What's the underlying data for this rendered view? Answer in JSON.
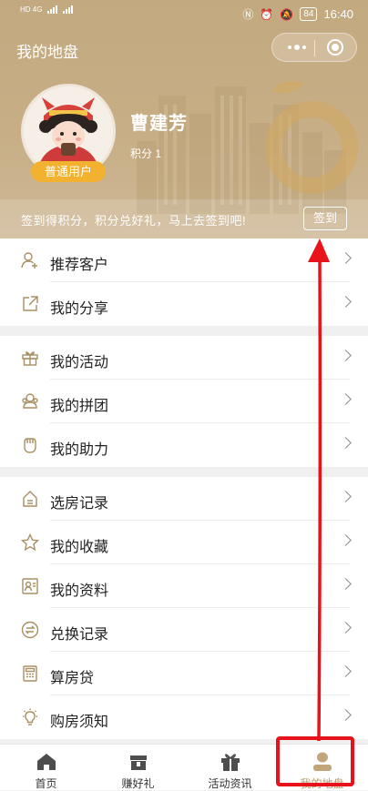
{
  "status_bar": {
    "left_text": "HD 4G",
    "battery": "84",
    "time": "16:40",
    "icons": [
      "nfc-icon",
      "alarm-icon",
      "mute-icon",
      "battery-icon"
    ]
  },
  "header": {
    "title": "我的地盘",
    "capsule": {
      "more_icon": "more-dots-icon",
      "close_icon": "target-icon"
    }
  },
  "profile": {
    "name": "曹建芳",
    "points": "积分 1",
    "badge": "普通用户",
    "avatar_icon": "child-avatar"
  },
  "signin": {
    "text": "签到得积分，积分兑好礼，马上去签到吧!",
    "button": "签到"
  },
  "menu": {
    "groups": [
      [
        {
          "label": "推荐客户",
          "icon": "person-add-icon"
        },
        {
          "label": "我的分享",
          "icon": "share-icon"
        }
      ],
      [
        {
          "label": "我的活动",
          "icon": "gift-icon"
        },
        {
          "label": "我的拼团",
          "icon": "group-icon"
        },
        {
          "label": "我的助力",
          "icon": "fist-icon"
        }
      ],
      [
        {
          "label": "选房记录",
          "icon": "house-record-icon"
        },
        {
          "label": "我的收藏",
          "icon": "star-icon"
        },
        {
          "label": "我的资料",
          "icon": "profile-card-icon"
        },
        {
          "label": "兑换记录",
          "icon": "exchange-icon"
        },
        {
          "label": "算房贷",
          "icon": "calculator-icon"
        },
        {
          "label": "购房须知",
          "icon": "bulb-icon"
        }
      ]
    ]
  },
  "tabbar": {
    "tabs": [
      {
        "label": "首页",
        "icon": "home-icon"
      },
      {
        "label": "赚好礼",
        "icon": "gift-box-icon"
      },
      {
        "label": "活动资讯",
        "icon": "gift-icon"
      },
      {
        "label": "我的地盘",
        "icon": "user-icon"
      }
    ],
    "active_index": 3
  },
  "colors": {
    "brand": "#c3a97f",
    "badge": "#f2b230",
    "annotation": "#e8121a",
    "icon": "#a98f63"
  }
}
